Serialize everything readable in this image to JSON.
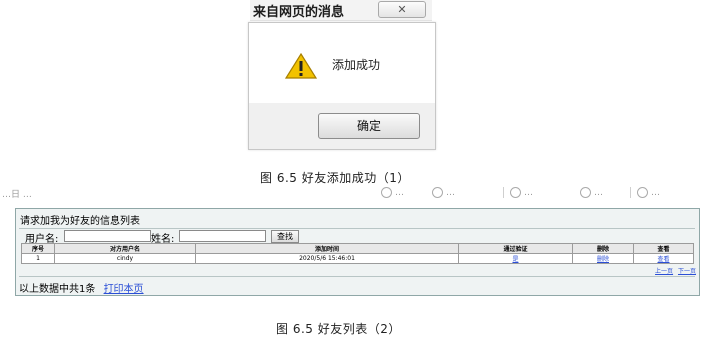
{
  "dialog": {
    "title": "来自网页的消息",
    "close_glyph": "✕",
    "message": "添加成功",
    "ok_label": "确定"
  },
  "caption1": "图 6.5 好友添加成功（1）",
  "toolbar": {
    "left_text": "…日 …",
    "items": [
      "…",
      "…",
      "…",
      "…",
      "…",
      "…"
    ]
  },
  "list": {
    "title": "请求加我为好友的信息列表",
    "username_label": "用户名:",
    "name_label": "姓名:",
    "search_label": "查找",
    "columns": [
      "序号",
      "对方用户名",
      "添加时间",
      "通过验证",
      "删除",
      "查看"
    ],
    "rows": [
      {
        "no": "1",
        "username": "cindy",
        "time": "2020/5/6 15:46:01",
        "verify": "是",
        "delete": "删除",
        "view": "查看"
      }
    ],
    "pager_prev": "上一页",
    "pager_next": "下一页",
    "footer_text": "以上数据中共1条",
    "print_label": "打印本页"
  },
  "caption2": "图 6.5 好友列表（2）"
}
